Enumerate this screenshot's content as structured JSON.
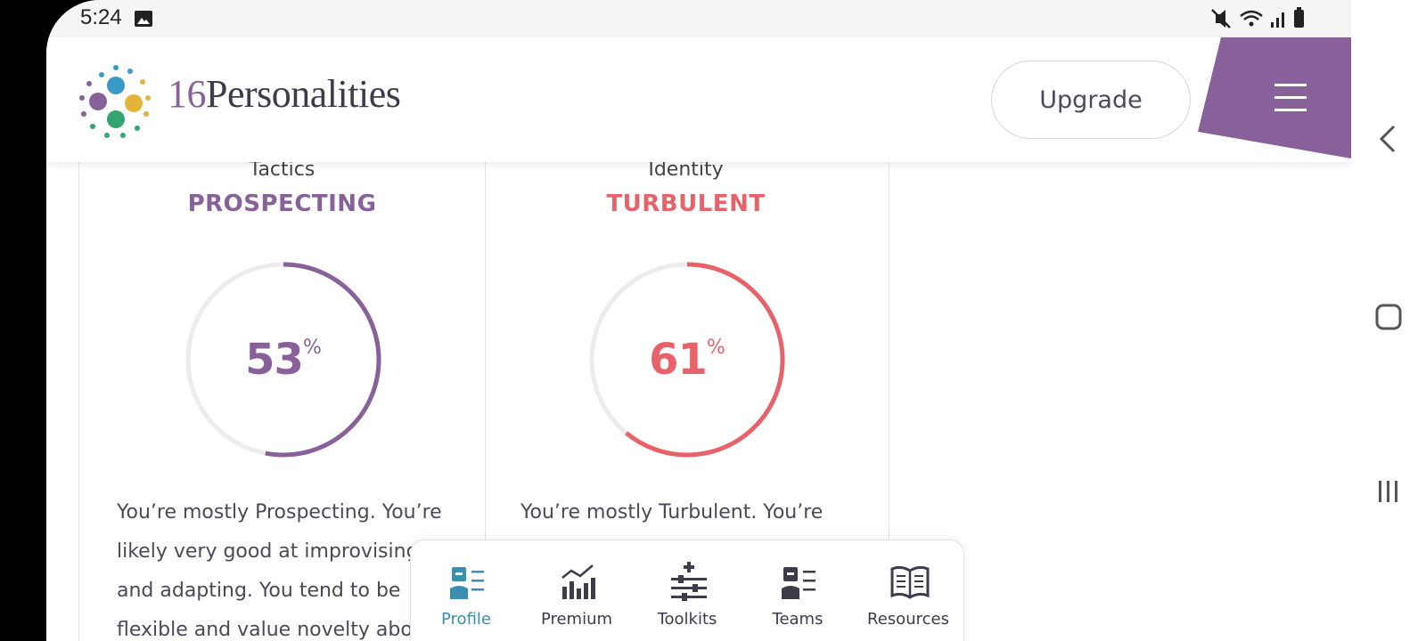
{
  "status_bar": {
    "time": "5:24"
  },
  "header": {
    "logo_number": "16",
    "logo_word": "Personalities",
    "upgrade_label": "Upgrade"
  },
  "cards": [
    {
      "trait": "Tactics",
      "value": "PROSPECTING",
      "percent": "53",
      "percent_sign": "%",
      "color": "#88619a",
      "description": "You’re mostly Prospecting. You’re likely very good at improvising and adapting. You tend to be flexible and value novelty abo"
    },
    {
      "trait": "Identity",
      "value": "TURBULENT",
      "percent": "61",
      "percent_sign": "%",
      "color": "#e8626a",
      "description": "You’re mostly Turbulent. You’re"
    }
  ],
  "tabs": [
    {
      "label": "Profile",
      "icon": "profile-icon",
      "active": true
    },
    {
      "label": "Premium",
      "icon": "premium-chart-icon",
      "active": false
    },
    {
      "label": "Toolkits",
      "icon": "toolkits-sliders-icon",
      "active": false
    },
    {
      "label": "Teams",
      "icon": "teams-icon",
      "active": false
    },
    {
      "label": "Resources",
      "icon": "resources-book-icon",
      "active": false
    }
  ],
  "colors": {
    "brand_purple": "#88619a",
    "accent_red": "#e8626a",
    "active_tab": "#3a8fb0"
  }
}
